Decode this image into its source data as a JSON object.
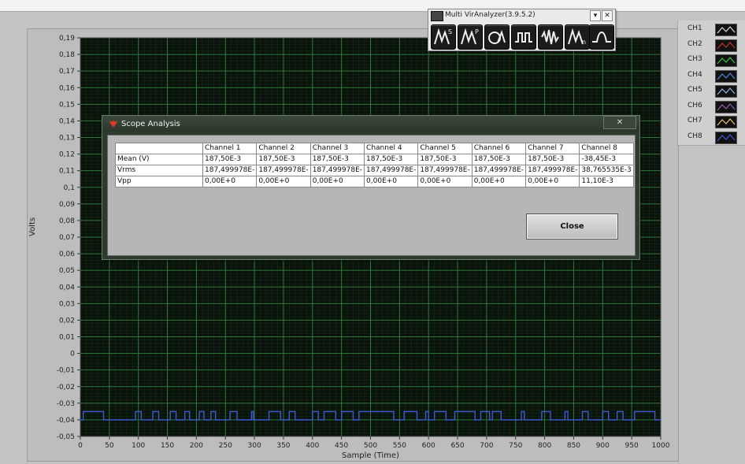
{
  "graph": {
    "y_axis_label": "Volts",
    "x_axis_label": "Sample (Time)",
    "y_ticks": [
      "0,19",
      "0,18",
      "0,17",
      "0,16",
      "0,15",
      "0,14",
      "0,13",
      "0,12",
      "0,11",
      "0,1",
      "0,09",
      "0,08",
      "0,07",
      "0,06",
      "0,05",
      "0,04",
      "0,03",
      "0,02",
      "0,01",
      "0",
      "-0,01",
      "-0,02",
      "-0,03",
      "-0,04",
      "-0,05"
    ],
    "x_ticks": [
      "0",
      "50",
      "100",
      "150",
      "200",
      "250",
      "300",
      "350",
      "400",
      "450",
      "500",
      "550",
      "600",
      "650",
      "700",
      "750",
      "800",
      "850",
      "900",
      "950",
      "1000"
    ],
    "plot_background": "#0b120b",
    "grid_color": "#1f5a2a",
    "trace_color": "#3d5bd8"
  },
  "chart_data": {
    "type": "line",
    "xlabel": "Sample (Time)",
    "ylabel": "Volts",
    "xlim": [
      0,
      1000
    ],
    "ylim": [
      -0.05,
      0.19
    ],
    "grid": true,
    "series": [
      {
        "color": "#3d5bd8",
        "x": [
          0,
          5,
          5,
          40,
          40,
          95,
          95,
          105,
          105,
          125,
          125,
          135,
          135,
          155,
          155,
          165,
          165,
          180,
          180,
          188,
          188,
          205,
          205,
          213,
          213,
          225,
          225,
          233,
          233,
          258,
          258,
          270,
          270,
          295,
          295,
          298,
          298,
          325,
          325,
          345,
          345,
          360,
          360,
          370,
          370,
          400,
          400,
          410,
          410,
          420,
          420,
          440,
          440,
          450,
          450,
          470,
          470,
          480,
          480,
          540,
          540,
          558,
          558,
          580,
          580,
          595,
          595,
          600,
          600,
          610,
          610,
          630,
          630,
          645,
          645,
          680,
          680,
          690,
          690,
          705,
          705,
          710,
          710,
          725,
          725,
          760,
          760,
          765,
          765,
          795,
          795,
          810,
          810,
          835,
          835,
          840,
          840,
          865,
          865,
          875,
          875,
          900,
          900,
          910,
          910,
          925,
          925,
          935,
          935,
          955,
          955,
          990,
          990,
          1000
        ],
        "y": [
          -0.04,
          -0.04,
          -0.035,
          -0.035,
          -0.04,
          -0.04,
          -0.035,
          -0.035,
          -0.04,
          -0.04,
          -0.035,
          -0.035,
          -0.04,
          -0.04,
          -0.035,
          -0.035,
          -0.04,
          -0.04,
          -0.035,
          -0.035,
          -0.04,
          -0.04,
          -0.035,
          -0.035,
          -0.04,
          -0.04,
          -0.035,
          -0.035,
          -0.04,
          -0.04,
          -0.035,
          -0.035,
          -0.04,
          -0.04,
          -0.035,
          -0.035,
          -0.04,
          -0.04,
          -0.035,
          -0.035,
          -0.04,
          -0.04,
          -0.035,
          -0.035,
          -0.04,
          -0.04,
          -0.035,
          -0.035,
          -0.04,
          -0.04,
          -0.035,
          -0.035,
          -0.04,
          -0.04,
          -0.035,
          -0.035,
          -0.04,
          -0.04,
          -0.035,
          -0.035,
          -0.04,
          -0.04,
          -0.035,
          -0.035,
          -0.04,
          -0.04,
          -0.035,
          -0.035,
          -0.04,
          -0.04,
          -0.035,
          -0.035,
          -0.04,
          -0.04,
          -0.035,
          -0.035,
          -0.04,
          -0.04,
          -0.035,
          -0.035,
          -0.04,
          -0.04,
          -0.035,
          -0.035,
          -0.04,
          -0.04,
          -0.035,
          -0.035,
          -0.04,
          -0.04,
          -0.035,
          -0.035,
          -0.04,
          -0.04,
          -0.035,
          -0.035,
          -0.04,
          -0.04,
          -0.035,
          -0.035,
          -0.04,
          -0.04,
          -0.035,
          -0.035,
          -0.04,
          -0.04,
          -0.035,
          -0.035,
          -0.04,
          -0.04,
          -0.035,
          -0.035,
          -0.04,
          -0.04
        ]
      }
    ]
  },
  "analyzer": {
    "title": "Multi VirAnalyzer(3.9.5.2)",
    "minimize_glyph": "▾",
    "close_glyph": "✕",
    "tools": [
      {
        "icon": "peak-s-icon"
      },
      {
        "icon": "peak-p-icon"
      },
      {
        "icon": "waveform-circle-icon"
      },
      {
        "icon": "square-wave-icon"
      },
      {
        "icon": "burst-wave-icon"
      },
      {
        "icon": "peak-n-icon"
      },
      {
        "icon": "pulse-icon"
      }
    ]
  },
  "legend": {
    "channels": [
      {
        "name": "CH1",
        "color": "#dcdcdc"
      },
      {
        "name": "CH2",
        "color": "#c0392b"
      },
      {
        "name": "CH3",
        "color": "#2ecc40"
      },
      {
        "name": "CH4",
        "color": "#4b8cd8"
      },
      {
        "name": "CH5",
        "color": "#9ab7e0"
      },
      {
        "name": "CH6",
        "color": "#9b59b6"
      },
      {
        "name": "CH7",
        "color": "#f0c36a"
      },
      {
        "name": "CH8",
        "color": "#3d5bd8"
      }
    ]
  },
  "dialog": {
    "title": "Scope Analysis",
    "close_x": "✕",
    "close_button": "Close",
    "columns": [
      "",
      "Channel 1",
      "Channel 2",
      "Channel 3",
      "Channel 4",
      "Channel 5",
      "Channel 6",
      "Channel 7",
      "Channel 8"
    ],
    "rows": [
      {
        "label": "Mean (V)",
        "values": [
          "187,50E-3",
          "187,50E-3",
          "187,50E-3",
          "187,50E-3",
          "187,50E-3",
          "187,50E-3",
          "187,50E-3",
          "-38,45E-3"
        ]
      },
      {
        "label": "Vrms",
        "values": [
          "187,499978E-",
          "187,499978E-",
          "187,499978E-",
          "187,499978E-",
          "187,499978E-",
          "187,499978E-",
          "187,499978E-",
          "38,765535E-3"
        ]
      },
      {
        "label": "Vpp",
        "values": [
          "0,00E+0",
          "0,00E+0",
          "0,00E+0",
          "0,00E+0",
          "0,00E+0",
          "0,00E+0",
          "0,00E+0",
          "11,10E-3"
        ]
      }
    ]
  }
}
